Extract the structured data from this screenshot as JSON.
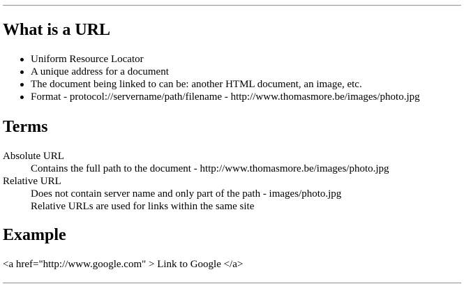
{
  "section_url": {
    "title": "What is a URL",
    "items": [
      "Uniform Resource Locator",
      "A unique address for a document",
      "The document being linked to can be: another HTML document, an image, etc.",
      "Format - protocol://servername/path/filename - http://www.thomasmore.be/images/photo.jpg"
    ]
  },
  "section_terms": {
    "title": "Terms",
    "absolute": {
      "term": "Absolute URL",
      "definition": "Contains the full path to the document - http://www.thomasmore.be/images/photo.jpg"
    },
    "relative": {
      "term": "Relative URL",
      "definitions": [
        "Does not contain server name and only part of the path - images/photo.jpg",
        "Relative URLs are used for links within the same site"
      ]
    }
  },
  "section_example": {
    "title": "Example",
    "code": "<a href=\"http://www.google.com\" > Link to Google </a>"
  }
}
